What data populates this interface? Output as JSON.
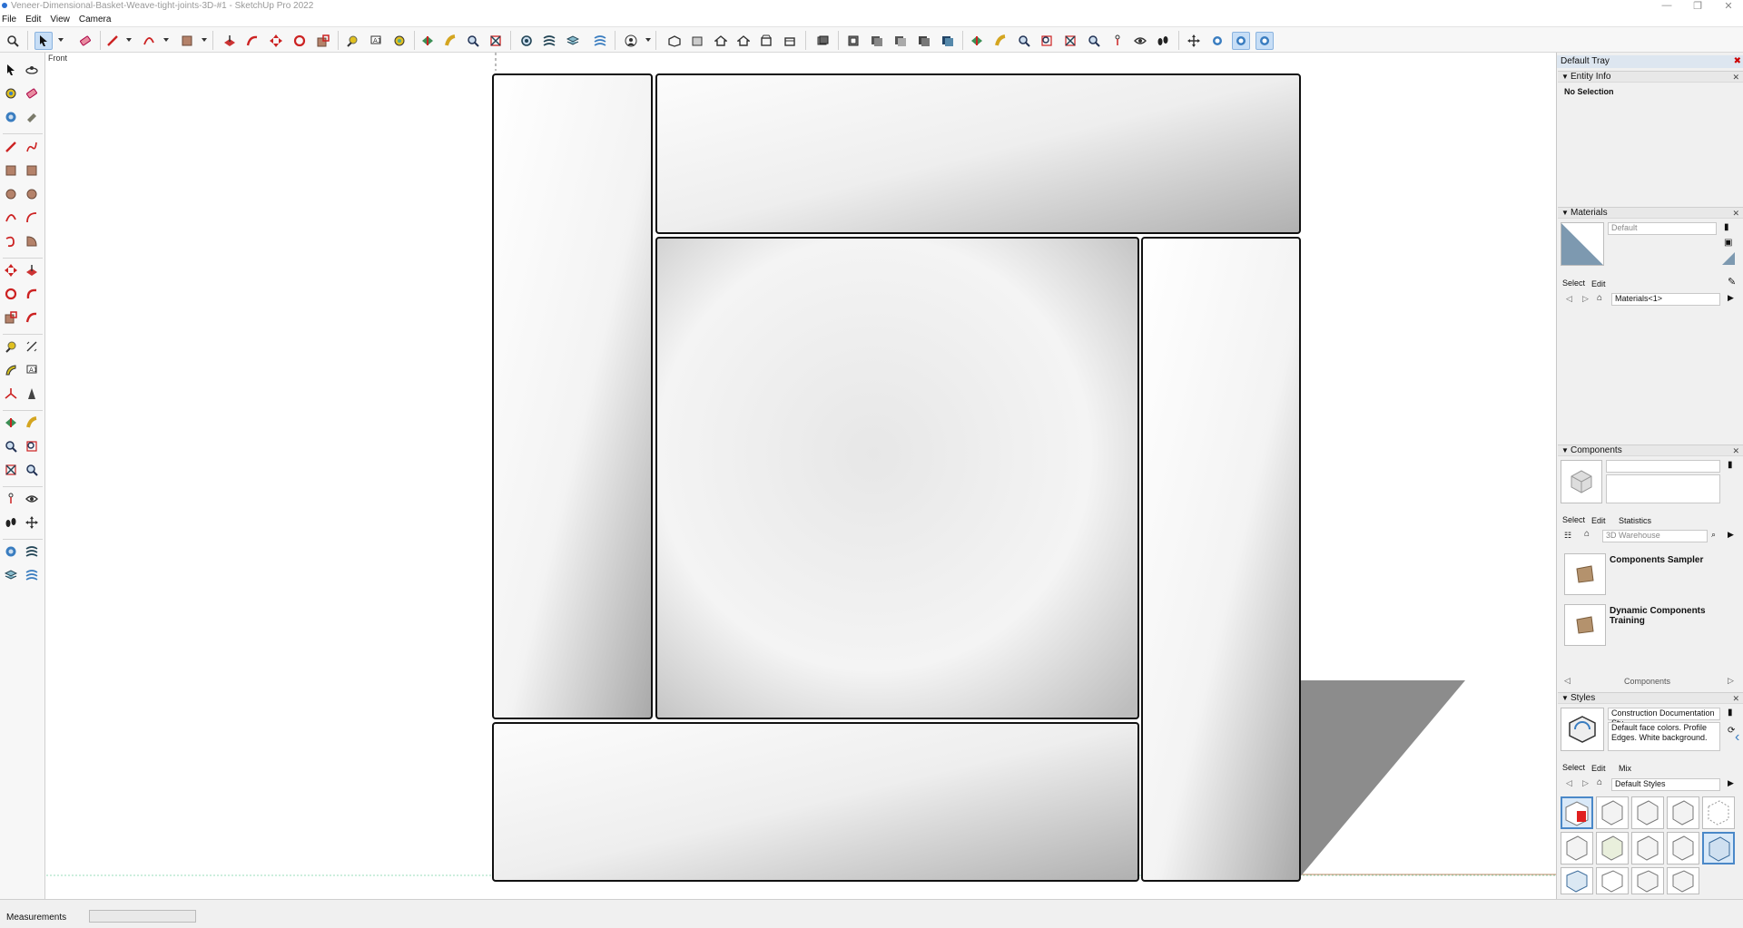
{
  "window": {
    "title": "Veneer-Dimensional-Basket-Weave-tight-joints-3D-#1 - SketchUp Pro 2022"
  },
  "menu": {
    "file": "File",
    "edit": "Edit",
    "view": "View",
    "camera": "Camera"
  },
  "toolbar_icons": [
    "search-icon",
    "select-arrow-icon",
    "eraser-icon",
    "pencil-icon",
    "arc-icon",
    "paint-bucket-icon",
    "push-pull-icon",
    "follow-me-icon",
    "move-icon",
    "rotate-icon",
    "scale-icon",
    "tape-measure-icon",
    "text-icon",
    "paint-icon",
    "section-plane-icon",
    "zoom-icon",
    "zoom-extents-icon",
    "outer-shell-icon",
    "intersect-icon",
    "union-icon",
    "subtract-icon",
    "user-icon",
    "iso-view-icon",
    "top-view-icon",
    "front-view-icon",
    "right-view-icon",
    "back-view-icon",
    "left-view-icon",
    "xray-icon",
    "wireframe-icon",
    "hidden-line-icon",
    "shaded-icon",
    "shaded-textures-icon",
    "monochrome-icon",
    "orbit-icon",
    "pan-icon",
    "zoom-window-icon",
    "zoom-extents-2-icon",
    "previous-view-icon",
    "position-camera-icon",
    "look-around-icon",
    "walk-icon",
    "section-plane-2-icon",
    "display-section-icon",
    "display-cuts-icon",
    "section-fill-icon"
  ],
  "viewport": {
    "scene_label": "Front"
  },
  "tray": {
    "title": "Default Tray",
    "entity_info": {
      "header": "Entity Info",
      "status": "No Selection"
    },
    "materials": {
      "header": "Materials",
      "name": "Default",
      "tab_select": "Select",
      "tab_edit": "Edit",
      "collection": "Materials<1>"
    },
    "components": {
      "header": "Components",
      "tab_select": "Select",
      "tab_edit": "Edit",
      "tab_statistics": "Statistics",
      "search_placeholder": "3D Warehouse",
      "items": [
        {
          "name": "Components Sampler"
        },
        {
          "name": "Dynamic Components Training"
        }
      ],
      "footer": "Components"
    },
    "styles": {
      "header": "Styles",
      "name": "Construction Documentation Sty",
      "description": "Default face colors. Profile Edges. White background.",
      "tab_select": "Select",
      "tab_edit": "Edit",
      "tab_mix": "Mix",
      "collection": "Default Styles"
    }
  },
  "status": {
    "measurements_label": "Measurements",
    "measurements_value": ""
  }
}
